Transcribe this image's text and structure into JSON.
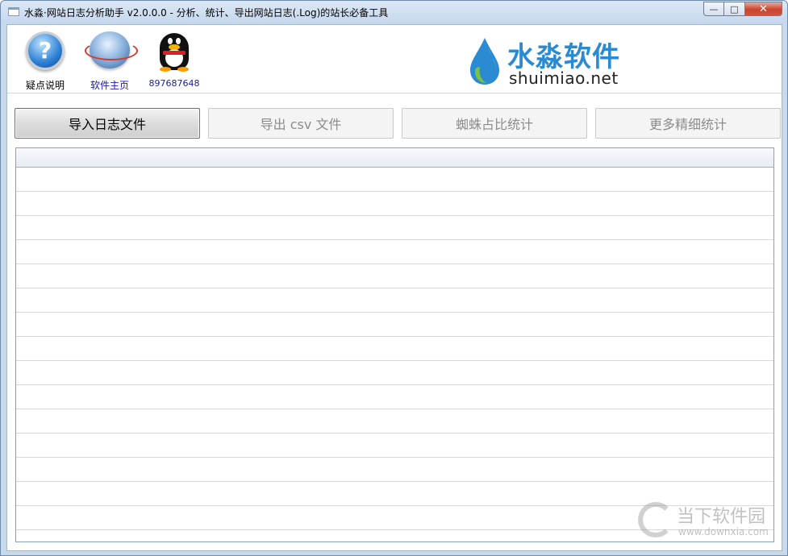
{
  "window": {
    "title": "水淼·网站日志分析助手 v2.0.0.0 - 分析、统计、导出网站日志(.Log)的站长必备工具",
    "controls": {
      "minimize": "—",
      "maximize": "□",
      "close": "✕"
    }
  },
  "toolbar": {
    "items": [
      {
        "label": "疑点说明",
        "icon": "help-icon"
      },
      {
        "label": "软件主页",
        "icon": "globe-icon"
      },
      {
        "label": "897687648",
        "icon": "qq-penguin-icon"
      }
    ]
  },
  "brand": {
    "name_cn": "水淼软件",
    "domain": "shuimiao.net",
    "accent": "#2a8bd3"
  },
  "actions": [
    {
      "label": "导入日志文件",
      "enabled": true
    },
    {
      "label": "导出 csv 文件",
      "enabled": false
    },
    {
      "label": "蜘蛛占比统计",
      "enabled": false
    },
    {
      "label": "更多精细统计",
      "enabled": false
    }
  ],
  "watermark": {
    "name_cn": "当下软件园",
    "url": "www.downxia.com"
  }
}
